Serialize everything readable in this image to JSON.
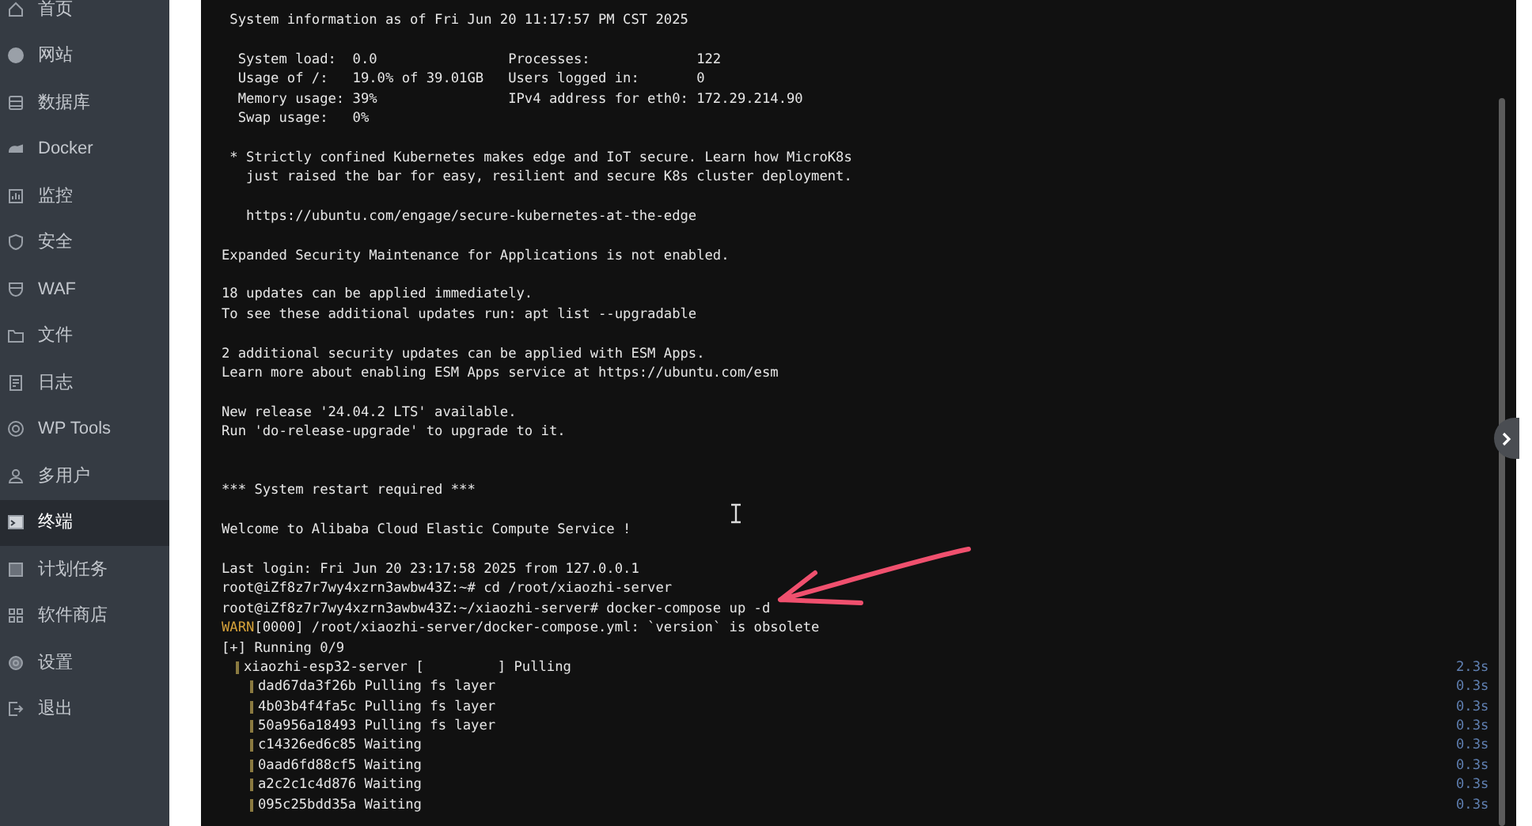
{
  "sidebar": {
    "items": [
      {
        "label": "首页",
        "selected": false
      },
      {
        "label": "网站",
        "selected": false
      },
      {
        "label": "数据库",
        "selected": false
      },
      {
        "label": "Docker",
        "selected": false
      },
      {
        "label": "监控",
        "selected": false
      },
      {
        "label": "安全",
        "selected": false
      },
      {
        "label": "WAF",
        "selected": false
      },
      {
        "label": "文件",
        "selected": false
      },
      {
        "label": "日志",
        "selected": false
      },
      {
        "label": "WP Tools",
        "selected": false
      },
      {
        "label": "多用户",
        "selected": false
      },
      {
        "label": "终端",
        "selected": true
      },
      {
        "label": "计划任务",
        "selected": false
      },
      {
        "label": "软件商店",
        "selected": false
      },
      {
        "label": "设置",
        "selected": false
      },
      {
        "label": "退出",
        "selected": false
      }
    ]
  },
  "terminal": {
    "lines": [
      {
        "kind": "text",
        "text": " System information as of Fri Jun 20 11:17:57 PM CST 2025"
      },
      {
        "kind": "blank"
      },
      {
        "kind": "text",
        "text": "  System load:  0.0                Processes:             122"
      },
      {
        "kind": "text",
        "text": "  Usage of /:   19.0% of 39.01GB   Users logged in:       0"
      },
      {
        "kind": "text",
        "text": "  Memory usage: 39%                IPv4 address for eth0: 172.29.214.90"
      },
      {
        "kind": "text",
        "text": "  Swap usage:   0%"
      },
      {
        "kind": "blank"
      },
      {
        "kind": "text",
        "text": " * Strictly confined Kubernetes makes edge and IoT secure. Learn how MicroK8s"
      },
      {
        "kind": "text",
        "text": "   just raised the bar for easy, resilient and secure K8s cluster deployment."
      },
      {
        "kind": "blank"
      },
      {
        "kind": "text",
        "text": "   https://ubuntu.com/engage/secure-kubernetes-at-the-edge"
      },
      {
        "kind": "blank"
      },
      {
        "kind": "text",
        "text": "Expanded Security Maintenance for Applications is not enabled."
      },
      {
        "kind": "blank"
      },
      {
        "kind": "text",
        "text": "18 updates can be applied immediately."
      },
      {
        "kind": "text",
        "text": "To see these additional updates run: apt list --upgradable"
      },
      {
        "kind": "blank"
      },
      {
        "kind": "text",
        "text": "2 additional security updates can be applied with ESM Apps."
      },
      {
        "kind": "text",
        "text": "Learn more about enabling ESM Apps service at https://ubuntu.com/esm"
      },
      {
        "kind": "blank"
      },
      {
        "kind": "text",
        "text": "New release '24.04.2 LTS' available."
      },
      {
        "kind": "text",
        "text": "Run 'do-release-upgrade' to upgrade to it."
      },
      {
        "kind": "blank"
      },
      {
        "kind": "blank"
      },
      {
        "kind": "text",
        "text": "*** System restart required ***"
      },
      {
        "kind": "blank"
      },
      {
        "kind": "text",
        "text": "Welcome to Alibaba Cloud Elastic Compute Service !"
      },
      {
        "kind": "blank"
      },
      {
        "kind": "text",
        "text": "Last login: Fri Jun 20 23:17:58 2025 from 127.0.0.1"
      },
      {
        "kind": "text",
        "text": "root@iZf8z7r7wy4xzrn3awbw43Z:~# cd /root/xiaozhi-server"
      },
      {
        "kind": "text",
        "text": "root@iZf8z7r7wy4xzrn3awbw43Z:~/xiaozhi-server# docker-compose up -d"
      },
      {
        "kind": "warn",
        "tag": "WARN",
        "text": "[0000] /root/xiaozhi-server/docker-compose.yml: `version` is obsolete"
      },
      {
        "kind": "text",
        "text": "[+] Running 0/9"
      },
      {
        "kind": "progress",
        "text": "xiaozhi-esp32-server [         ] Pulling",
        "duration": "2.3s",
        "children": [
          {
            "text": "dad67da3f26b Pulling fs layer",
            "duration": "0.3s"
          },
          {
            "text": "4b03b4f4fa5c Pulling fs layer",
            "duration": "0.3s"
          },
          {
            "text": "50a956a18493 Pulling fs layer",
            "duration": "0.3s"
          },
          {
            "text": "c14326ed6c85 Waiting",
            "duration": "0.3s"
          },
          {
            "text": "0aad6fd88cf5 Waiting",
            "duration": "0.3s"
          },
          {
            "text": "a2c2c1c4d876 Waiting",
            "duration": "0.3s"
          },
          {
            "text": "095c25bdd35a Waiting",
            "duration": "0.3s"
          }
        ]
      }
    ]
  }
}
